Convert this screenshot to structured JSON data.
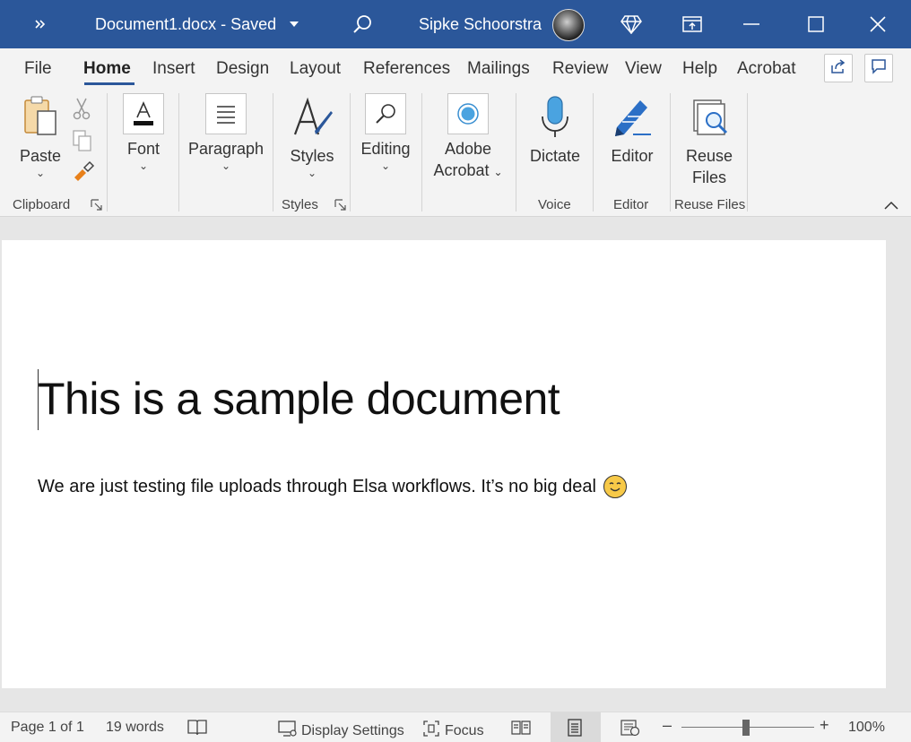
{
  "titlebar": {
    "document_title": "Document1.docx  -  Saved",
    "user_name": "Sipke Schoorstra"
  },
  "tabs": [
    {
      "label": "File",
      "active": false
    },
    {
      "label": "Home",
      "active": true
    },
    {
      "label": "Insert",
      "active": false
    },
    {
      "label": "Design",
      "active": false
    },
    {
      "label": "Layout",
      "active": false
    },
    {
      "label": "References",
      "active": false
    },
    {
      "label": "Mailings",
      "active": false
    },
    {
      "label": "Review",
      "active": false
    },
    {
      "label": "View",
      "active": false
    },
    {
      "label": "Help",
      "active": false
    },
    {
      "label": "Acrobat",
      "active": false
    }
  ],
  "ribbon": {
    "paste": "Paste",
    "font": "Font",
    "paragraph": "Paragraph",
    "styles": "Styles",
    "editing": "Editing",
    "adobe_acrobat_1": "Adobe",
    "adobe_acrobat_2": "Acrobat",
    "dictate": "Dictate",
    "editor": "Editor",
    "reuse_files_1": "Reuse",
    "reuse_files_2": "Files",
    "groups": {
      "clipboard": "Clipboard",
      "styles": "Styles",
      "voice": "Voice",
      "editor": "Editor",
      "reuse_files": "Reuse Files"
    }
  },
  "document": {
    "title": "This is a sample document",
    "body": "We are just testing file uploads through Elsa workflows. It’s no big deal",
    "emoji": "smiling-face-icon"
  },
  "statusbar": {
    "page": "Page 1 of 1",
    "words": "19 words",
    "display_settings": "Display Settings",
    "focus": "Focus",
    "zoom": "100%"
  },
  "colors": {
    "titlebar": "#2b579a",
    "ribbon_bg": "#f3f3f3",
    "accent": "#2b579a"
  }
}
